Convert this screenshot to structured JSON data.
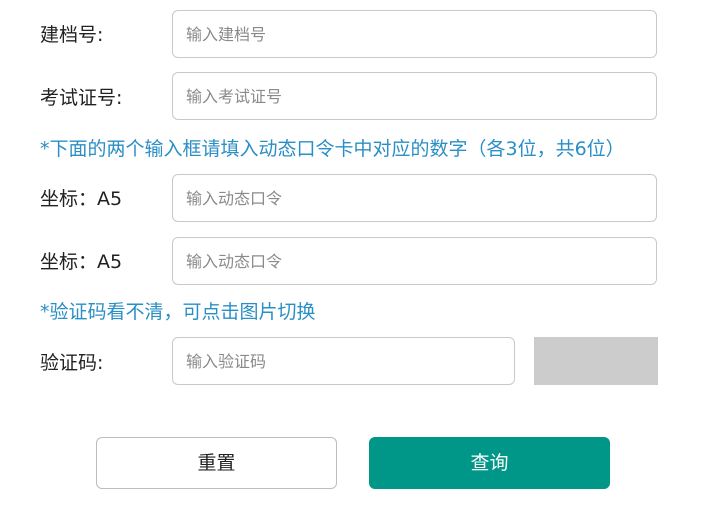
{
  "form": {
    "archive_no": {
      "label": "建档号:",
      "placeholder": "输入建档号",
      "value": ""
    },
    "exam_cert_no": {
      "label": "考试证号:",
      "placeholder": "输入考试证号",
      "value": ""
    },
    "dynamic_note": "*下面的两个输入框请填入动态口令卡中对应的数字（各3位，共6位）",
    "coord1": {
      "label": "坐标：A5",
      "placeholder": "输入动态口令",
      "value": ""
    },
    "coord2": {
      "label": "坐标：A5",
      "placeholder": "输入动态口令",
      "value": ""
    },
    "captcha_note": "*验证码看不清，可点击图片切换",
    "captcha": {
      "label": "验证码:",
      "placeholder": "输入验证码",
      "value": ""
    }
  },
  "buttons": {
    "reset": "重置",
    "query": "查询"
  },
  "colors": {
    "note": "#2a8fc6",
    "primary": "#009688",
    "captcha_bg": "#cccccc"
  }
}
